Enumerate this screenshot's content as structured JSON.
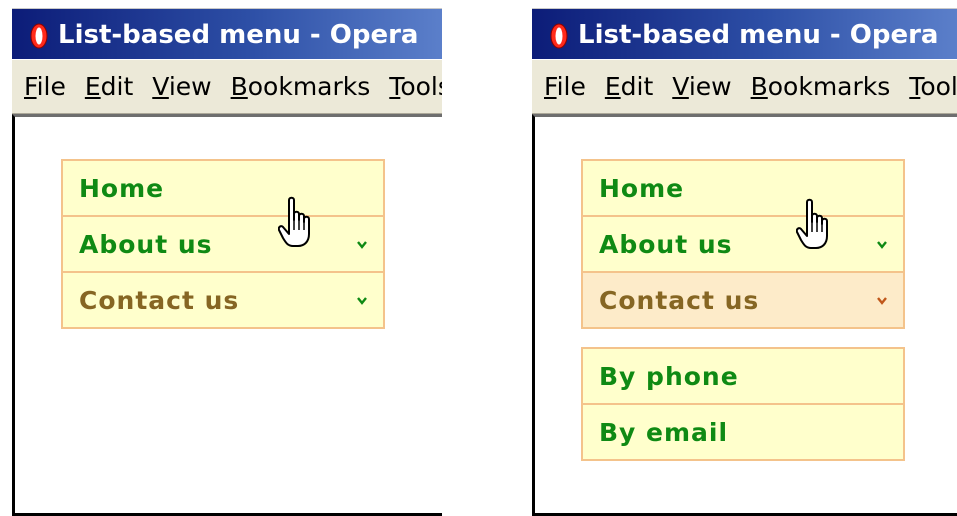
{
  "screens": [
    {
      "title": "List-based menu - Opera",
      "menu": [
        "File",
        "Edit",
        "View",
        "Bookmarks",
        "Tools"
      ],
      "nav": [
        {
          "label": "Home",
          "has_submenu": false
        },
        {
          "label": "About us",
          "has_submenu": true
        },
        {
          "label": "Contact us",
          "has_submenu": true,
          "state": "hover-cursor"
        }
      ]
    },
    {
      "title": "List-based menu - Opera",
      "menu": [
        "File",
        "Edit",
        "View",
        "Bookmarks",
        "Tools"
      ],
      "nav": [
        {
          "label": "Home",
          "has_submenu": false
        },
        {
          "label": "About us",
          "has_submenu": true
        },
        {
          "label": "Contact us",
          "has_submenu": true,
          "state": "expanded-hover"
        }
      ],
      "submenu": [
        {
          "label": "By phone"
        },
        {
          "label": "By email"
        }
      ]
    }
  ],
  "icons": {
    "app": "opera-logo-icon",
    "chevron": "chevron-down-icon",
    "cursor": "hand-pointer-icon"
  },
  "colors": {
    "titlebar_dark": "#0c1c78",
    "titlebar_light": "#5b7fca",
    "item_bg": "#ffffcc",
    "item_border": "#f4c38b",
    "item_text": "#0f8a14",
    "hover_bg": "#fdebc9",
    "hover_text": "#866623"
  }
}
